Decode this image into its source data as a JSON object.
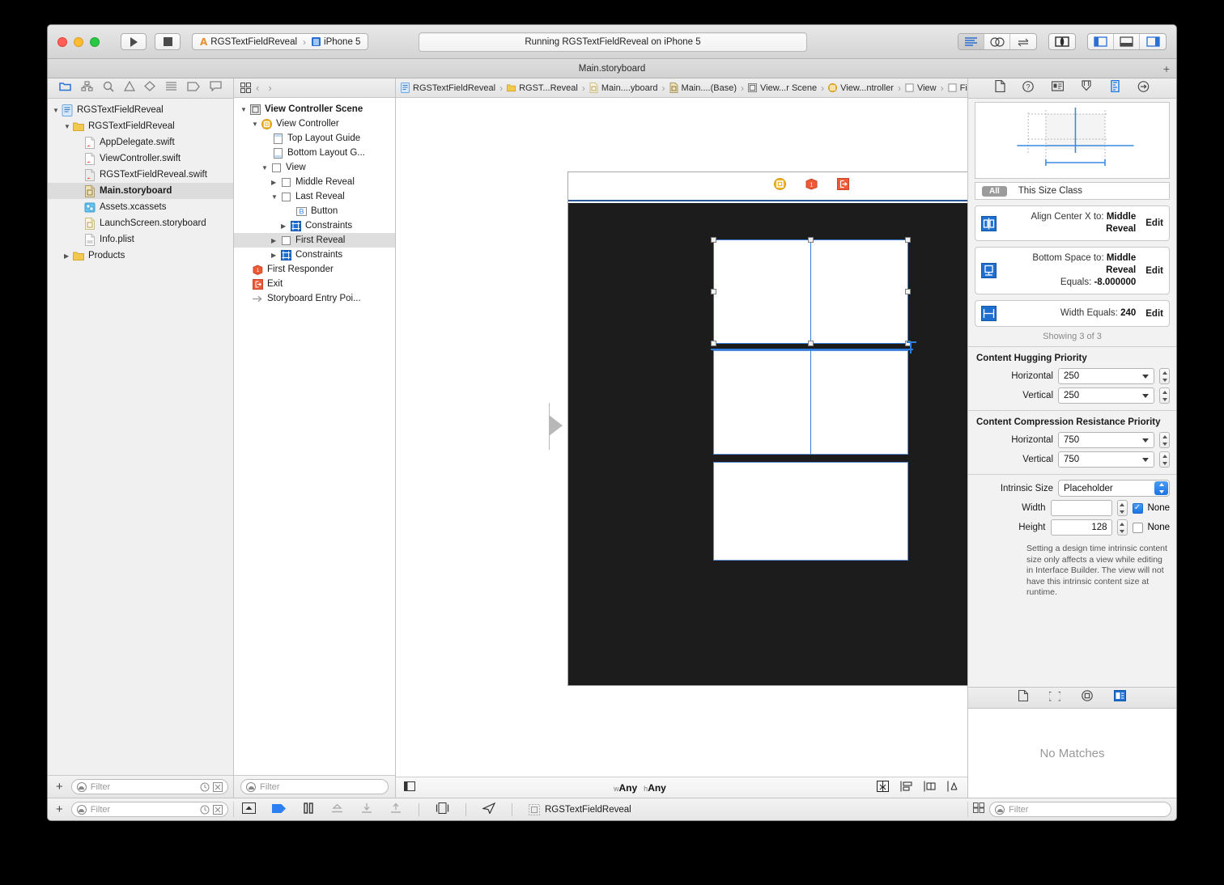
{
  "toolbar": {
    "scheme_project": "RGSTextFieldReveal",
    "scheme_device": "iPhone 5",
    "scheme_separator": "›",
    "status_text": "Running RGSTextFieldReveal on iPhone 5",
    "run_tooltip": "Run",
    "stop_tooltip": "Stop",
    "editor_segments": [
      "standard-editor-icon",
      "assistant-editor-icon",
      "version-editor-icon"
    ],
    "view_toggle": "hide-show-toolbar-icon",
    "panel_segments": [
      "navigator-toggle-icon",
      "debug-area-toggle-icon",
      "utilities-toggle-icon"
    ]
  },
  "tabbar": {
    "title": "Main.storyboard",
    "add_label": "+"
  },
  "navigator": {
    "tabs": [
      "project-navigator-icon",
      "symbol-navigator-icon",
      "find-navigator-icon",
      "issue-navigator-icon",
      "test-navigator-icon",
      "debug-navigator-icon",
      "breakpoint-navigator-icon",
      "report-navigator-icon"
    ],
    "selected_tab_index": 0,
    "items": [
      {
        "label": "RGSTextFieldReveal",
        "indent": 0,
        "twisty": "down",
        "icon": "project-icon",
        "selected": false
      },
      {
        "label": "RGSTextFieldReveal",
        "indent": 1,
        "twisty": "down",
        "icon": "folder-icon",
        "selected": false
      },
      {
        "label": "AppDelegate.swift",
        "indent": 2,
        "twisty": "",
        "icon": "swift-file-icon",
        "selected": false
      },
      {
        "label": "ViewController.swift",
        "indent": 2,
        "twisty": "",
        "icon": "swift-file-icon",
        "selected": false
      },
      {
        "label": "RGSTextFieldReveal.swift",
        "indent": 2,
        "twisty": "",
        "icon": "swift-file-icon",
        "selected": false
      },
      {
        "label": "Main.storyboard",
        "indent": 2,
        "twisty": "",
        "icon": "storyboard-icon",
        "selected": true
      },
      {
        "label": "Assets.xcassets",
        "indent": 2,
        "twisty": "",
        "icon": "assets-icon",
        "selected": false
      },
      {
        "label": "LaunchScreen.storyboard",
        "indent": 2,
        "twisty": "",
        "icon": "storyboard-icon",
        "selected": false
      },
      {
        "label": "Info.plist",
        "indent": 2,
        "twisty": "",
        "icon": "plist-icon",
        "selected": false
      },
      {
        "label": "Products",
        "indent": 1,
        "twisty": "right",
        "icon": "folder-icon",
        "selected": false
      }
    ],
    "add_button": "+",
    "filter_placeholder": "Filter",
    "filter_value": "",
    "recent_icon": "clock-icon",
    "source_control_icon": "source-control-filter-icon"
  },
  "outline": {
    "items": [
      {
        "label": "View Controller Scene",
        "indent": 0,
        "twisty": "down",
        "icon": "scene-icon",
        "bold": true,
        "selected": false
      },
      {
        "label": "View Controller",
        "indent": 1,
        "twisty": "down",
        "icon": "view-controller-icon",
        "bold": false,
        "selected": false
      },
      {
        "label": "Top Layout Guide",
        "indent": 2,
        "twisty": "",
        "icon": "top-layout-guide-icon",
        "bold": false,
        "selected": false
      },
      {
        "label": "Bottom Layout G...",
        "indent": 2,
        "twisty": "",
        "icon": "bottom-layout-guide-icon",
        "bold": false,
        "selected": false
      },
      {
        "label": "View",
        "indent": 2,
        "twisty": "down",
        "icon": "view-icon",
        "bold": false,
        "selected": false
      },
      {
        "label": "Middle Reveal",
        "indent": 3,
        "twisty": "right",
        "icon": "view-icon",
        "bold": false,
        "selected": false
      },
      {
        "label": "Last Reveal",
        "indent": 3,
        "twisty": "down",
        "icon": "view-icon",
        "bold": false,
        "selected": false
      },
      {
        "label": "Button",
        "indent": 4,
        "twisty": "",
        "icon": "button-icon",
        "bold": false,
        "selected": false
      },
      {
        "label": "Constraints",
        "indent": 4,
        "twisty": "right",
        "icon": "constraints-icon",
        "bold": false,
        "selected": false
      },
      {
        "label": "First Reveal",
        "indent": 3,
        "twisty": "right",
        "icon": "view-icon",
        "bold": false,
        "selected": true
      },
      {
        "label": "Constraints",
        "indent": 3,
        "twisty": "right",
        "icon": "constraints-icon",
        "bold": false,
        "selected": false
      },
      {
        "label": "First Responder",
        "indent": 1,
        "twisty": "",
        "icon": "first-responder-icon",
        "bold": false,
        "selected": false
      },
      {
        "label": "Exit",
        "indent": 1,
        "twisty": "",
        "icon": "exit-icon",
        "bold": false,
        "selected": false
      },
      {
        "label": "Storyboard Entry Poi...",
        "indent": 1,
        "twisty": "",
        "icon": "entry-point-icon",
        "bold": false,
        "selected": false
      }
    ],
    "filter_placeholder": "Filter",
    "filter_value": ""
  },
  "jumpbar": {
    "back_label": "‹",
    "forward_label": "›",
    "separator": "›",
    "items": [
      {
        "label": "RGSTextFieldReveal",
        "icon": "project-icon"
      },
      {
        "label": "RGST...Reveal",
        "icon": "folder-icon"
      },
      {
        "label": "Main....yboard",
        "icon": "storyboard-icon"
      },
      {
        "label": "Main....(Base)",
        "icon": "storyboard-base-icon"
      },
      {
        "label": "View...r Scene",
        "icon": "scene-icon"
      },
      {
        "label": "View...ntroller",
        "icon": "view-controller-icon"
      },
      {
        "label": "View",
        "icon": "view-icon"
      },
      {
        "label": "First Reveal",
        "icon": "view-icon"
      }
    ]
  },
  "canvas": {
    "scene_icons": [
      "view-controller-icon",
      "first-responder-icon",
      "exit-icon"
    ],
    "entry_point": "storyboard-entry-point-arrow",
    "size_class_w_prefix": "w",
    "size_class_w_value": "Any",
    "size_class_h_prefix": "h",
    "size_class_h_value": "Any",
    "bottom_icons": [
      "auto-layout-align-icon",
      "auto-layout-pin-icon",
      "resolve-auto-layout-icon",
      "update-frames-icon"
    ],
    "document_outline_toggle": "document-outline-toggle-icon"
  },
  "inspector": {
    "tabs": [
      "file-inspector-icon",
      "quick-help-icon",
      "identity-inspector-icon",
      "attributes-inspector-icon",
      "size-inspector-icon",
      "connections-inspector-icon"
    ],
    "selected_tab_index": 4,
    "size_class_all": "All",
    "size_class_label": "This Size Class",
    "constraints": [
      {
        "icon": "align-center-x-icon",
        "label": "Align Center X to:",
        "value": "Middle Reveal",
        "label2": "",
        "value2": "",
        "edit": "Edit"
      },
      {
        "icon": "bottom-space-icon",
        "label": "Bottom Space to:",
        "value": "Middle Reveal",
        "label2": "Equals:",
        "value2": "-8.000000",
        "edit": "Edit"
      },
      {
        "icon": "width-equals-icon",
        "label": "Width Equals:",
        "value": "240",
        "label2": "",
        "value2": "",
        "edit": "Edit"
      }
    ],
    "showing": "Showing 3 of 3",
    "hugging_title": "Content Hugging Priority",
    "hugging_horizontal_label": "Horizontal",
    "hugging_horizontal_value": "250",
    "hugging_vertical_label": "Vertical",
    "hugging_vertical_value": "250",
    "compression_title": "Content Compression Resistance Priority",
    "compression_horizontal_label": "Horizontal",
    "compression_horizontal_value": "750",
    "compression_vertical_label": "Vertical",
    "compression_vertical_value": "750",
    "intrinsic_label": "Intrinsic Size",
    "intrinsic_value": "Placeholder",
    "width_label": "Width",
    "width_value": "",
    "width_none_label": "None",
    "width_none_checked": true,
    "height_label": "Height",
    "height_value": "128",
    "height_none_label": "None",
    "height_none_checked": false,
    "help_text": "Setting a design time intrinsic content size only affects a view while editing in Interface Builder. The view will not have this intrinsic content size at runtime.",
    "library_tabs": [
      "file-template-library-icon",
      "code-snippet-library-icon",
      "object-library-icon",
      "media-library-icon"
    ],
    "library_selected_index": 3,
    "library_empty": "No Matches",
    "filter_placeholder": "Filter",
    "filter_value": "",
    "library_layout_toggle": "library-grid-toggle-icon"
  },
  "debugbar": {
    "breakpoint_icon": "breakpoint-toggle-icon",
    "continue_icon": "continue-icon",
    "pause_icon": "pause-icon",
    "step_over_icon": "step-over-icon",
    "step_into_icon": "step-into-icon",
    "step_out_icon": "step-out-icon",
    "view_hierarchy_icon": "debug-view-hierarchy-icon",
    "location_icon": "simulate-location-icon",
    "process_label": "RGSTextFieldReveal",
    "process_icon": "process-icon",
    "left_toggle_icon": "navigator-panel-toggle-icon",
    "right_toggle_icon": "utilities-panel-toggle-icon",
    "filter_placeholder": "Filter",
    "filter_value": ""
  },
  "colors": {
    "accent_blue": "#1a74e2",
    "selection_blue": "#3a7fd5",
    "folder_yellow": "#f4c84e",
    "orange": "#f25f3e",
    "canvas_dark": "#1c1c1c"
  }
}
